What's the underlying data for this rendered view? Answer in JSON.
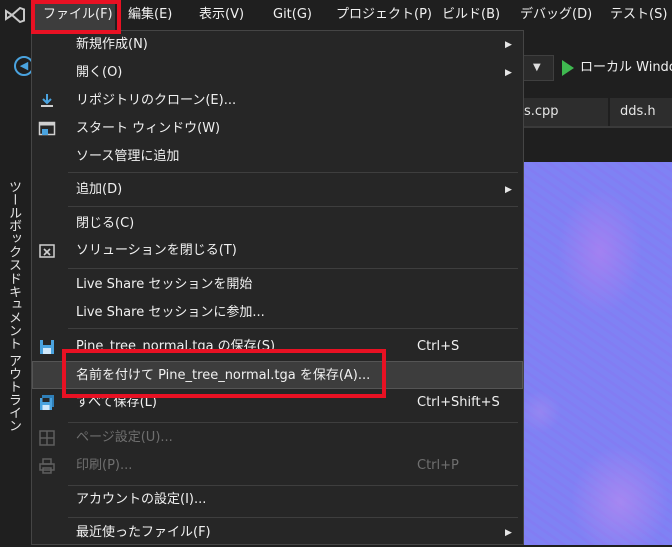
{
  "menubar": {
    "items": [
      {
        "label": "ファイル(F)"
      },
      {
        "label": "編集(E)"
      },
      {
        "label": "表示(V)"
      },
      {
        "label": "Git(G)"
      },
      {
        "label": "プロジェクト(P)"
      },
      {
        "label": "ビルド(B)"
      },
      {
        "label": "デバッグ(D)"
      },
      {
        "label": "テスト(S)"
      }
    ]
  },
  "toolbar": {
    "run_label": "ローカル Windo",
    "dropdown_arrow": "▼"
  },
  "tabs": [
    {
      "label": "s.cpp"
    },
    {
      "label": "dds.h"
    }
  ],
  "side_panel": {
    "toolbox": "ツールボックス",
    "outline": "ドキュメント アウトライン"
  },
  "file_menu": {
    "items": [
      {
        "label": "新規作成(N)",
        "arrow": "▶"
      },
      {
        "label": "開く(O)",
        "arrow": "▶"
      },
      {
        "label": "リポジトリのクローン(E)...",
        "icon": "download-icon"
      },
      {
        "label": "スタート ウィンドウ(W)",
        "icon": "start-window-icon"
      },
      {
        "label": "ソース管理に追加"
      },
      {
        "label": "追加(D)",
        "arrow": "▶"
      },
      {
        "label": "閉じる(C)"
      },
      {
        "label": "ソリューションを閉じる(T)",
        "icon": "close-solution-icon"
      },
      {
        "label": "Live Share セッションを開始"
      },
      {
        "label": "Live Share セッションに参加..."
      },
      {
        "label": "Pine_tree_normal.tga の保存(S)",
        "shortcut": "Ctrl+S",
        "icon": "save-icon"
      },
      {
        "label": "名前を付けて Pine_tree_normal.tga を保存(A)..."
      },
      {
        "label": "すべて保存(L)",
        "shortcut": "Ctrl+Shift+S",
        "icon": "save-all-icon"
      },
      {
        "label": "ページ設定(U)...",
        "icon": "page-setup-icon"
      },
      {
        "label": "印刷(P)...",
        "shortcut": "Ctrl+P",
        "icon": "print-icon"
      },
      {
        "label": "アカウントの設定(I)..."
      },
      {
        "label": "最近使ったファイル(F)",
        "arrow": "▶"
      }
    ]
  },
  "colors": {
    "accent_red": "#e81123",
    "menu_bg": "#262626",
    "app_bg": "#1f1f1f",
    "run_green": "#3fb950",
    "normal_map": "#7f82f4"
  }
}
